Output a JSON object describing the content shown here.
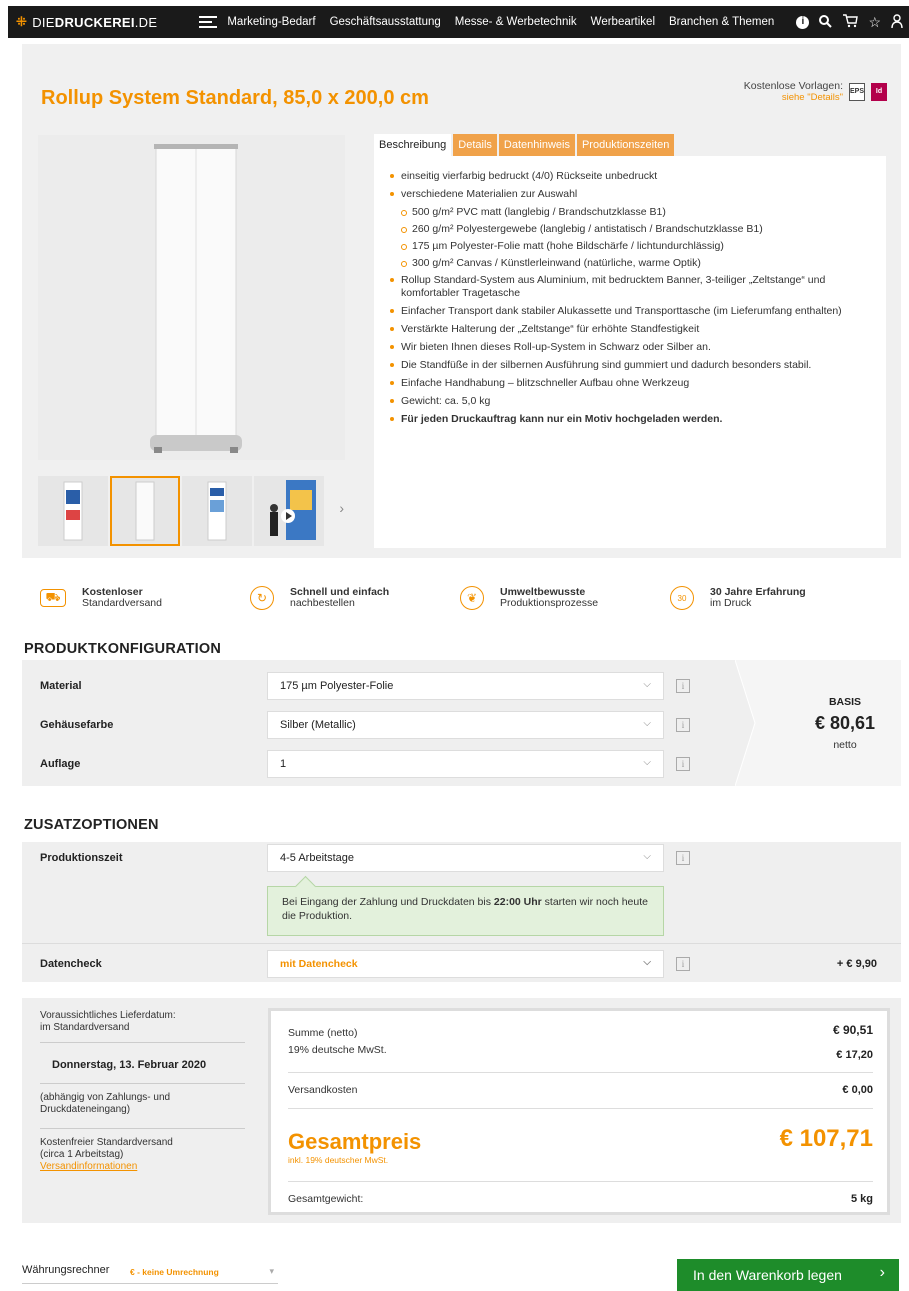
{
  "nav": {
    "logo_prefix": "DIE",
    "logo_main": "DRUCKEREI",
    "logo_suffix": ".DE",
    "items": [
      "Marketing-Bedarf",
      "Geschäftsausstattung",
      "Messe- & Werbetechnik",
      "Werbeartikel",
      "Branchen & Themen"
    ],
    "icons": [
      "info-icon",
      "search-icon",
      "cart-icon",
      "star-icon",
      "user-icon"
    ]
  },
  "product": {
    "title": "Rollup System Standard, 85,0 x 200,0 cm",
    "templates_label": "Kostenlose Vorlagen:",
    "templates_link": "siehe \"Details\"",
    "file_icons": [
      "EPS",
      "Id"
    ]
  },
  "tabs": [
    "Beschreibung",
    "Details",
    "Datenhinweis",
    "Produktionszeiten"
  ],
  "description": {
    "bullets": [
      {
        "text": "einseitig vierfarbig bedruckt (4/0) Rückseite unbedruckt",
        "type": "main"
      },
      {
        "text": "verschiedene Materialien zur Auswahl",
        "type": "main"
      },
      {
        "text": "500 g/m² PVC matt (langlebig / Brandschutzklasse B1)",
        "type": "sub"
      },
      {
        "text": "260 g/m² Polyestergewebe (langlebig / antistatisch / Brandschutzklasse B1)",
        "type": "sub"
      },
      {
        "text": "175 µm Polyester-Folie matt (hohe Bildschärfe / lichtundurchlässig)",
        "type": "sub"
      },
      {
        "text": "300 g/m² Canvas / Künstlerleinwand (natürliche, warme Optik)",
        "type": "sub"
      },
      {
        "text": "Rollup Standard-System aus Aluminium, mit bedrucktem Banner, 3-teiliger „Zeltstange“ und komfortabler Tragetasche",
        "type": "main"
      },
      {
        "text": "Einfacher Transport dank stabiler Alukassette und Transporttasche (im Lieferumfang enthalten)",
        "type": "main"
      },
      {
        "text": "Verstärkte Halterung der „Zeltstange“ für erhöhte Standfestigkeit",
        "type": "main"
      },
      {
        "text": "Wir bieten Ihnen dieses Roll-up-System in Schwarz oder Silber an.",
        "type": "main"
      },
      {
        "text": "Die Standfüße in der silbernen Ausführung sind gummiert und dadurch besonders stabil.",
        "type": "main"
      },
      {
        "text": "Einfache Handhabung – blitzschneller Aufbau ohne Werkzeug",
        "type": "main"
      },
      {
        "text": "Gewicht: ca. 5,0 kg",
        "type": "main"
      },
      {
        "text": "Für jeden Druckauftrag kann nur ein Motiv hochgeladen werden.",
        "type": "bold"
      }
    ]
  },
  "usps": [
    {
      "title": "Kostenloser",
      "sub": "Standardversand",
      "icon": "truck-icon"
    },
    {
      "title": "Schnell und einfach",
      "sub": "nachbestellen",
      "icon": "reorder-icon"
    },
    {
      "title": "Umweltbewusste",
      "sub": "Produktionsprozesse",
      "icon": "leaf-icon"
    },
    {
      "title": "30 Jahre Erfahrung",
      "sub": "im Druck",
      "icon": "award-icon"
    }
  ],
  "config": {
    "heading": "PRODUKTKONFIGURATION",
    "rows": [
      {
        "label": "Material",
        "value": "175 µm Polyester-Folie"
      },
      {
        "label": "Gehäusefarbe",
        "value": "Silber (Metallic)"
      },
      {
        "label": "Auflage",
        "value": "1"
      }
    ],
    "price_label": "BASIS",
    "price": "€ 80,61",
    "price_note": "netto"
  },
  "extras": {
    "heading": "ZUSATZOPTIONEN",
    "production_label": "Produktionszeit",
    "production_value": "4-5 Arbeitstage",
    "hint_pre": "Bei Eingang der Zahlung und Druckdaten bis ",
    "hint_bold": "22:00 Uhr",
    "hint_post": " starten wir noch heute die Produktion.",
    "datacheck_label": "Datencheck",
    "datacheck_value": "mit Datencheck",
    "datacheck_price": "+ € 9,90"
  },
  "delivery": {
    "label": "Voraussichtliches Lieferdatum:",
    "sub": "im Standardversand",
    "date": "Donnerstag, 13. Februar 2020",
    "note": "(abhängig von Zahlungs- und Druckdateneingang)",
    "ship1": "Kostenfreier Standardversand",
    "ship2": "(circa 1 Arbeitstag)",
    "link": "Versandinformationen"
  },
  "summary": {
    "sum_label": "Summe (netto)",
    "sum_value": "€ 90,51",
    "vat_label": "19% deutsche MwSt.",
    "vat_value": "€ 17,20",
    "ship_label": "Versandkosten",
    "ship_value": "€ 0,00",
    "total_label": "Gesamtpreis",
    "total_sub": "inkl. 19% deutscher MwSt.",
    "total_value": "€ 107,71",
    "weight_label": "Gesamtgewicht:",
    "weight_value": "5 kg"
  },
  "footer": {
    "currency_label": "Währungsrechner",
    "currency_value": "€ - keine Umrechnung",
    "cart_button": "In den Warenkorb legen"
  },
  "colors": {
    "accent": "#f39200",
    "cart": "#1e8c2a",
    "nav": "#1a1a1a"
  }
}
